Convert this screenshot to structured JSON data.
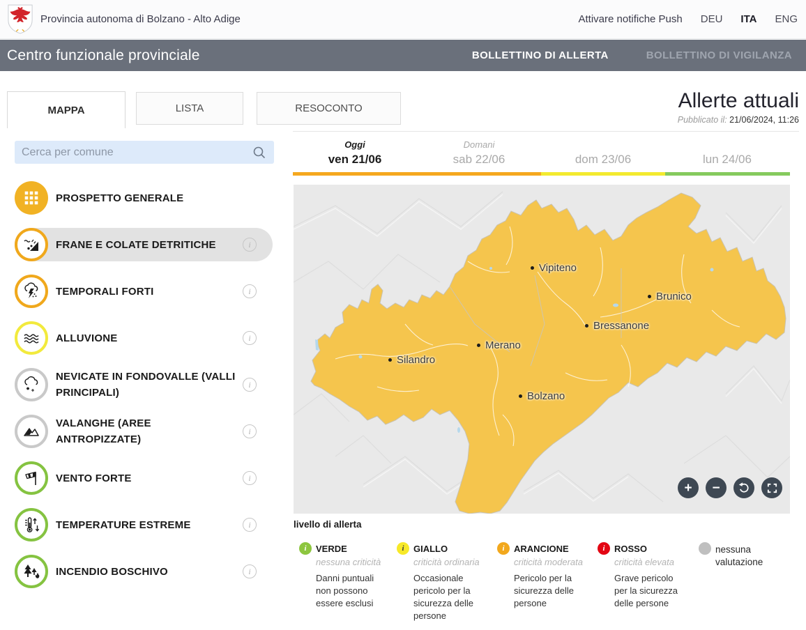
{
  "topbar": {
    "brand": "Provincia autonoma di Bolzano - Alto Adige",
    "push_label": "Attivare notifiche Push",
    "languages": [
      {
        "code": "DEU",
        "active": false
      },
      {
        "code": "ITA",
        "active": true
      },
      {
        "code": "ENG",
        "active": false
      }
    ]
  },
  "navbar": {
    "title": "Centro funzionale provinciale",
    "menu": [
      {
        "label": "BOLLETTINO DI ALLERTA",
        "active": true
      },
      {
        "label": "BOLLETTINO DI VIGILANZA",
        "active": false
      }
    ]
  },
  "tabs": [
    {
      "label": "MAPPA",
      "active": true
    },
    {
      "label": "LISTA",
      "active": false
    },
    {
      "label": "RESOCONTO",
      "active": false
    }
  ],
  "alerts_header": {
    "title": "Allerte attuali",
    "published_label": "Pubblicato il:",
    "published_value": "21/06/2024, 11:26"
  },
  "search": {
    "placeholder": "Cerca per comune"
  },
  "sidebar": {
    "items": [
      {
        "label": "PROSPETTO GENERALE",
        "icon": "grid-icon",
        "level": "prospetto",
        "color": "#f1b224",
        "selected": false,
        "has_info": false
      },
      {
        "label": "FRANE E COLATE DETRITICHE",
        "icon": "landslide-icon",
        "level": "arancione",
        "color": "#f0a81c",
        "selected": true,
        "has_info": true
      },
      {
        "label": "TEMPORALI FORTI",
        "icon": "thunderstorm-icon",
        "level": "arancione",
        "color": "#f0a81c",
        "selected": false,
        "has_info": true
      },
      {
        "label": "ALLUVIONE",
        "icon": "flood-waves-icon",
        "level": "giallo",
        "color": "#f2ea3d",
        "selected": false,
        "has_info": true
      },
      {
        "label": "NEVICATE IN FONDOVALLE (VALLI PRINCIPALI)",
        "icon": "snowfall-icon",
        "level": "nessuna valutazione",
        "color": "#c9c9c9",
        "selected": false,
        "has_info": true
      },
      {
        "label": "VALANGHE (AREE ANTROPIZZATE)",
        "icon": "avalanche-icon",
        "level": "nessuna valutazione",
        "color": "#c9c9c9",
        "selected": false,
        "has_info": true
      },
      {
        "label": "VENTO FORTE",
        "icon": "windsock-icon",
        "level": "verde",
        "color": "#85c341",
        "selected": false,
        "has_info": true
      },
      {
        "label": "TEMPERATURE ESTREME",
        "icon": "thermometer-icon",
        "level": "verde",
        "color": "#85c341",
        "selected": false,
        "has_info": true
      },
      {
        "label": "INCENDIO BOSCHIVO",
        "icon": "forest-fire-icon",
        "level": "verde",
        "color": "#85c341",
        "selected": false,
        "has_info": true
      }
    ]
  },
  "date_tabs": [
    {
      "top": "Oggi",
      "label": "ven 21/06",
      "underline": "#f5a81f",
      "active": true
    },
    {
      "top": "Domani",
      "label": "sab 22/06",
      "underline": "#f5a81f",
      "active": false
    },
    {
      "top": "",
      "label": "dom 23/06",
      "underline": "#f3ea2f",
      "active": false
    },
    {
      "top": "",
      "label": "lun 24/06",
      "underline": "#85ca5d",
      "active": false
    }
  ],
  "map": {
    "alert_fill": "#f5c54d",
    "cities": [
      {
        "name": "Vipiteno"
      },
      {
        "name": "Brunico"
      },
      {
        "name": "Bressanone"
      },
      {
        "name": "Merano"
      },
      {
        "name": "Silandro"
      },
      {
        "name": "Bolzano"
      }
    ],
    "controls": [
      {
        "name": "zoom-in",
        "glyph": "+"
      },
      {
        "name": "zoom-out",
        "glyph": "−"
      },
      {
        "name": "reset-view",
        "glyph": ""
      },
      {
        "name": "fullscreen",
        "glyph": ""
      }
    ]
  },
  "legend": {
    "title": "livello di allerta",
    "items": [
      {
        "name": "VERDE",
        "subtitle": "nessuna criticità",
        "description": "Danni puntuali non possono essere esclusi",
        "color": "#8dc63f",
        "icon_text": "i",
        "icon_text_color": "#ffffff"
      },
      {
        "name": "GIALLO",
        "subtitle": "criticità ordinaria",
        "description": "Occasionale pericolo per la sicurezza delle persone",
        "color": "#f7e928",
        "icon_text": "i",
        "icon_text_color": "#3a3a3a"
      },
      {
        "name": "ARANCIONE",
        "subtitle": "criticità moderata",
        "description": "Pericolo per la sicurezza delle persone",
        "color": "#f2a81d",
        "icon_text": "i",
        "icon_text_color": "#ffffff"
      },
      {
        "name": "ROSSO",
        "subtitle": "criticità elevata",
        "description": "Grave pericolo per la sicurezza delle persone",
        "color": "#e30613",
        "icon_text": "i",
        "icon_text_color": "#ffffff"
      },
      {
        "name": "nessuna valutazione",
        "subtitle": "",
        "description": "",
        "color": "#bfbfbf",
        "icon_text": "",
        "icon_text_color": "#bfbfbf"
      }
    ]
  }
}
